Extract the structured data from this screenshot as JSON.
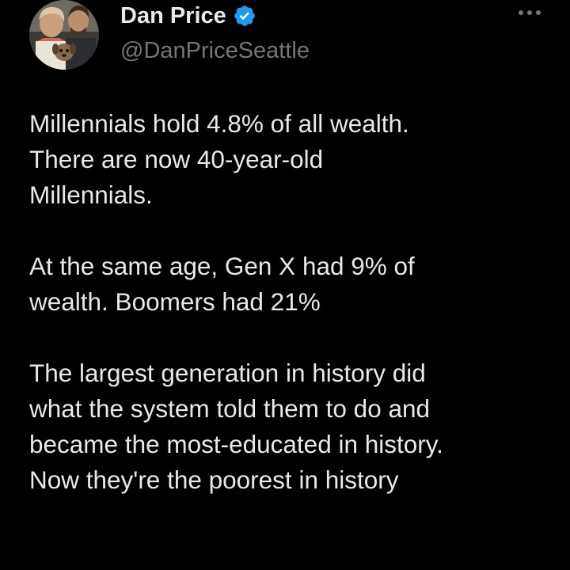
{
  "author": {
    "display_name": "Dan Price",
    "handle": "@DanPriceSeattle",
    "verified": true,
    "avatar_icon": "profile-photo-avatar",
    "verified_icon": "verified-badge-icon",
    "verified_color": "#1d9bf0"
  },
  "menu": {
    "icon": "more-options-icon"
  },
  "tweet": {
    "paragraphs": [
      {
        "lines": [
          "Millennials hold 4.8% of all wealth.",
          "There are now 40-year-old",
          "Millennials."
        ]
      },
      {
        "lines": [
          "At the same age, Gen X had 9% of",
          "wealth. Boomers had 21%"
        ]
      },
      {
        "lines": [
          "The largest generation in history did",
          "what the system told them to do and",
          "became the most-educated in history.",
          "Now they're the poorest in history"
        ]
      }
    ]
  },
  "colors": {
    "background": "#000000",
    "primary_text": "#e7e9ea",
    "secondary_text": "#71767b"
  }
}
